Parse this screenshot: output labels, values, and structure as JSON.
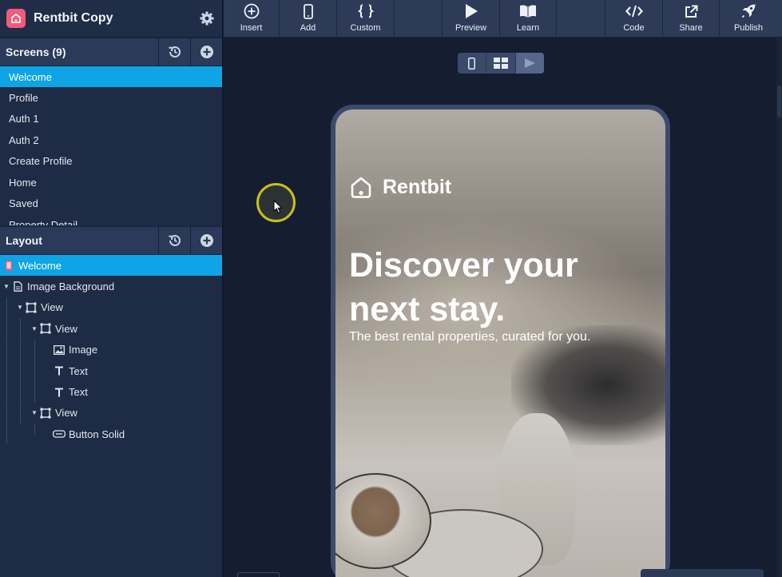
{
  "app": {
    "title": "Rentbit Copy"
  },
  "screens": {
    "header": "Screens (9)",
    "items": [
      "Welcome",
      "Profile",
      "Auth 1",
      "Auth 2",
      "Create Profile",
      "Home",
      "Saved",
      "Property Detail"
    ],
    "active": "Welcome"
  },
  "layout": {
    "header": "Layout",
    "tree": [
      {
        "label": "Welcome",
        "icon": "phone-icon"
      },
      {
        "label": "Image Background",
        "icon": "file-icon"
      },
      {
        "label": "View",
        "icon": "frame-icon"
      },
      {
        "label": "View",
        "icon": "frame-icon"
      },
      {
        "label": "Image",
        "icon": "image-icon"
      },
      {
        "label": "Text",
        "icon": "text-icon"
      },
      {
        "label": "Text",
        "icon": "text-icon"
      },
      {
        "label": "View",
        "icon": "frame-icon"
      },
      {
        "label": "Button Solid",
        "icon": "button-icon"
      }
    ]
  },
  "toolbar": {
    "insert": "Insert",
    "add": "Add",
    "custom": "Custom",
    "preview": "Preview",
    "learn": "Learn",
    "code": "Code",
    "share": "Share",
    "publish": "Publish"
  },
  "preview": {
    "brand": "Rentbit",
    "headline": "Discover your next stay.",
    "subtitle": "The best rental properties, curated for you."
  },
  "colors": {
    "accent": "#0ea4e5",
    "logo": "#f35a7c",
    "cursor_ring": "#c9bf1c"
  }
}
